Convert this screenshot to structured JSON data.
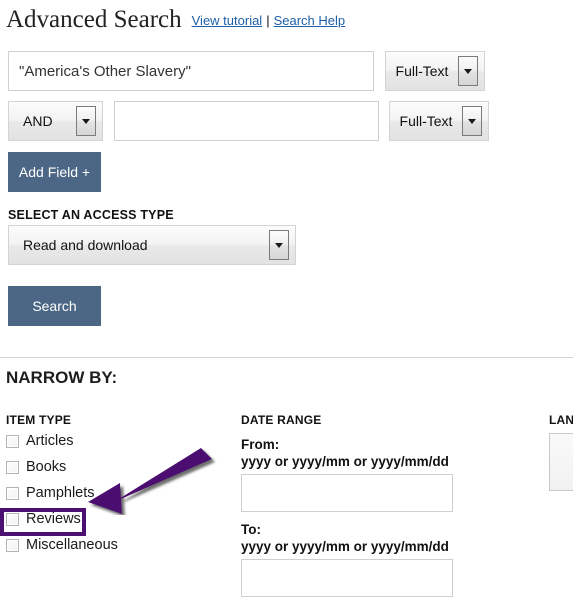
{
  "header": {
    "title": "Advanced Search",
    "links": [
      {
        "label": "View tutorial"
      },
      {
        "label": "Search Help"
      }
    ],
    "separator": "|"
  },
  "search": {
    "row1": {
      "query_value": "\"America's Other Slavery\"",
      "query_placeholder": "",
      "field_type": "Full-Text"
    },
    "row2": {
      "boolean_operator": "AND",
      "query_value": "",
      "query_placeholder": "",
      "field_type": "Full-Text"
    },
    "add_field_label": "Add Field +",
    "search_label": "Search"
  },
  "access_type": {
    "label": "SELECT AN ACCESS TYPE",
    "selected": "Read and download"
  },
  "narrow_by": {
    "heading": "NARROW BY:",
    "item_type": {
      "heading": "ITEM TYPE",
      "options": [
        {
          "label": "Articles",
          "checked": false
        },
        {
          "label": "Books",
          "checked": false
        },
        {
          "label": "Pamphlets",
          "checked": false
        },
        {
          "label": "Reviews",
          "checked": false
        },
        {
          "label": "Miscellaneous",
          "checked": false
        }
      ]
    },
    "date_range": {
      "heading": "DATE RANGE",
      "from_label": "From:",
      "from_format": "yyyy or yyyy/mm or yyyy/mm/dd",
      "from_value": "",
      "to_label": "To:",
      "to_format": "yyyy or yyyy/mm or yyyy/mm/dd",
      "to_value": ""
    },
    "language": {
      "heading": "LAN"
    }
  },
  "annotation": {
    "arrow_color": "#4b1070",
    "highlight_color": "#4b1070",
    "target": "Reviews"
  },
  "colors": {
    "button_blue": "#4c6785",
    "link_blue": "#1f5fa8",
    "annotation_purple": "#4b1070"
  }
}
